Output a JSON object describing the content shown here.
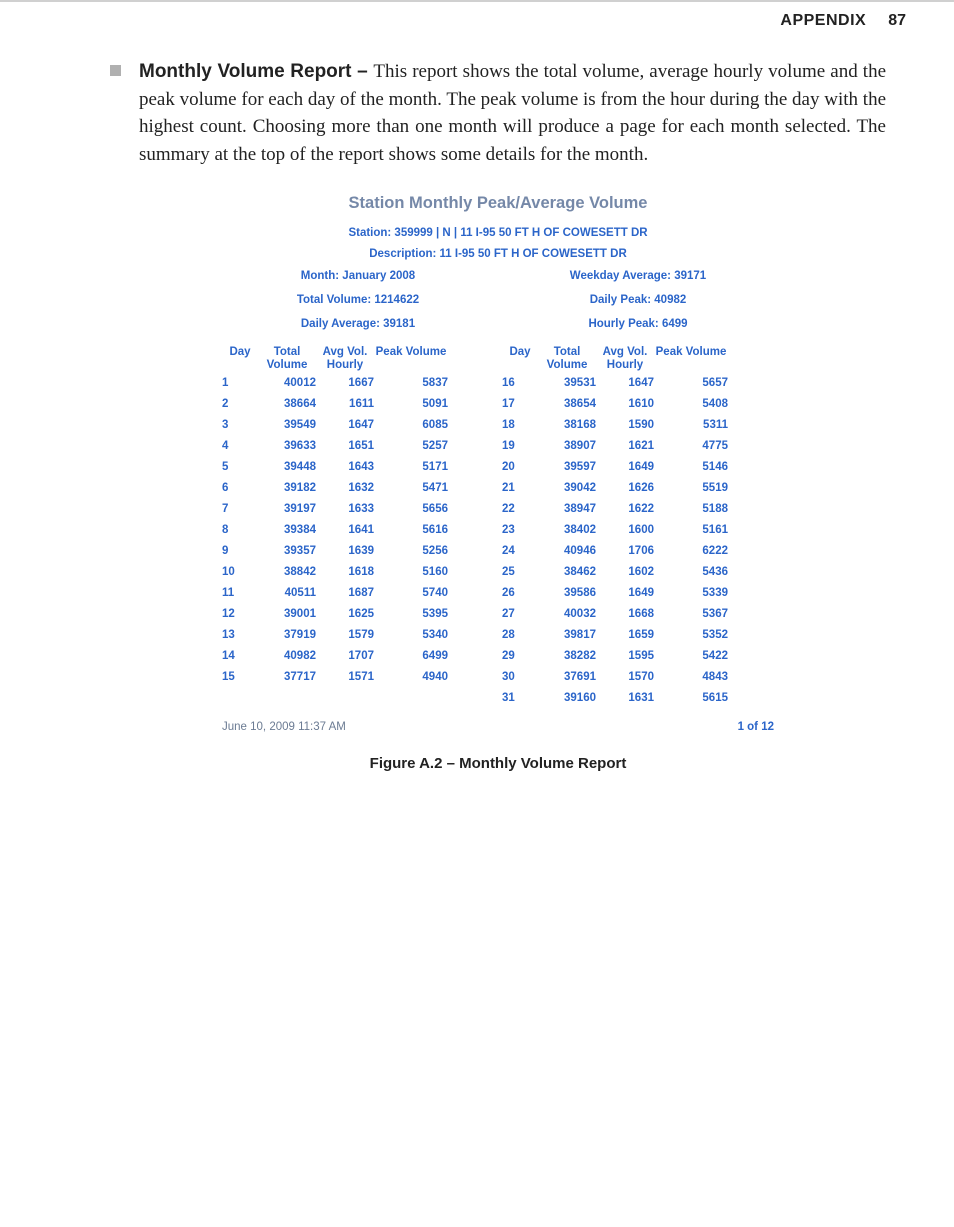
{
  "header": {
    "label": "APPENDIX",
    "page": "87"
  },
  "paragraph": {
    "lead": "Monthly Volume Report – ",
    "body": "This report shows the total volume, average hourly volume and the peak volume for each day of the month. The peak volume is from the hour during the day with the highest count. Choosing more than one month will produce a page for each month selected. The summary at the top of the report shows some details for the month."
  },
  "report": {
    "title": "Station Monthly Peak/Average Volume",
    "station": "Station: 359999 | N | 11 I-95 50 FT H OF COWESETT DR",
    "description": "Description: 11 I-95 50 FT H OF COWESETT DR",
    "meta_left": {
      "month": "Month: January 2008",
      "total_volume": "Total Volume: 1214622",
      "daily_avg": "Daily Average: 39181"
    },
    "meta_right": {
      "weekday_avg": "Weekday Average: 39171",
      "daily_peak": "Daily Peak: 40982",
      "hourly_peak": "Hourly Peak: 6499"
    },
    "columns": {
      "day": "Day",
      "total_volume": "Total Volume",
      "avg_hourly": "Avg Vol. Hourly",
      "peak_volume": "Peak Volume"
    },
    "rows_left": [
      {
        "day": "1",
        "tv": "40012",
        "avh": "1667",
        "pv": "5837"
      },
      {
        "day": "2",
        "tv": "38664",
        "avh": "1611",
        "pv": "5091"
      },
      {
        "day": "3",
        "tv": "39549",
        "avh": "1647",
        "pv": "6085"
      },
      {
        "day": "4",
        "tv": "39633",
        "avh": "1651",
        "pv": "5257"
      },
      {
        "day": "5",
        "tv": "39448",
        "avh": "1643",
        "pv": "5171"
      },
      {
        "day": "6",
        "tv": "39182",
        "avh": "1632",
        "pv": "5471"
      },
      {
        "day": "7",
        "tv": "39197",
        "avh": "1633",
        "pv": "5656"
      },
      {
        "day": "8",
        "tv": "39384",
        "avh": "1641",
        "pv": "5616"
      },
      {
        "day": "9",
        "tv": "39357",
        "avh": "1639",
        "pv": "5256"
      },
      {
        "day": "10",
        "tv": "38842",
        "avh": "1618",
        "pv": "5160"
      },
      {
        "day": "11",
        "tv": "40511",
        "avh": "1687",
        "pv": "5740"
      },
      {
        "day": "12",
        "tv": "39001",
        "avh": "1625",
        "pv": "5395"
      },
      {
        "day": "13",
        "tv": "37919",
        "avh": "1579",
        "pv": "5340"
      },
      {
        "day": "14",
        "tv": "40982",
        "avh": "1707",
        "pv": "6499"
      },
      {
        "day": "15",
        "tv": "37717",
        "avh": "1571",
        "pv": "4940"
      }
    ],
    "rows_right": [
      {
        "day": "16",
        "tv": "39531",
        "avh": "1647",
        "pv": "5657"
      },
      {
        "day": "17",
        "tv": "38654",
        "avh": "1610",
        "pv": "5408"
      },
      {
        "day": "18",
        "tv": "38168",
        "avh": "1590",
        "pv": "5311"
      },
      {
        "day": "19",
        "tv": "38907",
        "avh": "1621",
        "pv": "4775"
      },
      {
        "day": "20",
        "tv": "39597",
        "avh": "1649",
        "pv": "5146"
      },
      {
        "day": "21",
        "tv": "39042",
        "avh": "1626",
        "pv": "5519"
      },
      {
        "day": "22",
        "tv": "38947",
        "avh": "1622",
        "pv": "5188"
      },
      {
        "day": "23",
        "tv": "38402",
        "avh": "1600",
        "pv": "5161"
      },
      {
        "day": "24",
        "tv": "40946",
        "avh": "1706",
        "pv": "6222"
      },
      {
        "day": "25",
        "tv": "38462",
        "avh": "1602",
        "pv": "5436"
      },
      {
        "day": "26",
        "tv": "39586",
        "avh": "1649",
        "pv": "5339"
      },
      {
        "day": "27",
        "tv": "40032",
        "avh": "1668",
        "pv": "5367"
      },
      {
        "day": "28",
        "tv": "39817",
        "avh": "1659",
        "pv": "5352"
      },
      {
        "day": "29",
        "tv": "38282",
        "avh": "1595",
        "pv": "5422"
      },
      {
        "day": "30",
        "tv": "37691",
        "avh": "1570",
        "pv": "4843"
      },
      {
        "day": "31",
        "tv": "39160",
        "avh": "1631",
        "pv": "5615"
      }
    ],
    "footer": {
      "timestamp": "June 10, 2009 11:37 AM",
      "page": "1  of  12"
    }
  },
  "figure_caption": "Figure A.2 – Monthly Volume Report"
}
